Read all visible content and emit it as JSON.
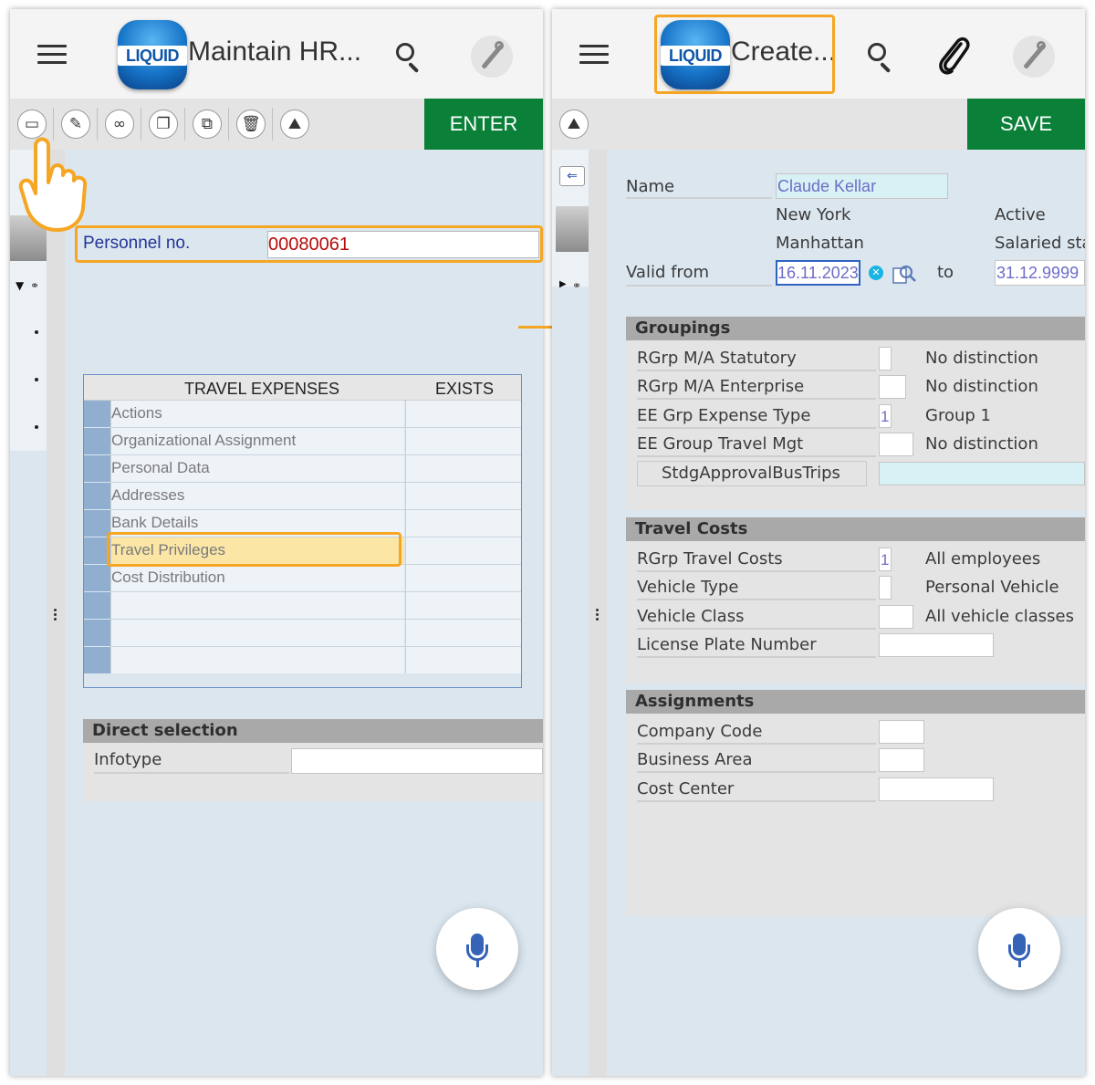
{
  "left": {
    "app_title": "Maintain HR...",
    "logo_text": "LIQUID",
    "enter_label": "ENTER",
    "toolbar_icons": [
      "create-icon",
      "change-icon",
      "display-icon",
      "copy-icon",
      "delimit-icon",
      "delete-icon",
      "overview-icon"
    ],
    "personnel_label": "Personnel no.",
    "personnel_value": "00080061",
    "table": {
      "headers": [
        "TRAVEL EXPENSES",
        "EXISTS"
      ],
      "rows": [
        "Actions",
        "Organizational Assignment",
        "Personal Data",
        "Addresses",
        "Bank Details",
        "Travel Privileges",
        "Cost Distribution",
        "",
        "",
        ""
      ],
      "highlighted": "Travel Privileges"
    },
    "direct_selection": {
      "title": "Direct selection",
      "infotype_label": "Infotype",
      "infotype_value": ""
    }
  },
  "right": {
    "app_title": "Create...",
    "logo_text": "LIQUID",
    "save_label": "SAVE",
    "header": {
      "name_label": "Name",
      "name_value": "Claude  Kellar",
      "city": "New York",
      "status": "Active",
      "area": "Manhattan",
      "group": "Salaried sta",
      "valid_from_label": "Valid from",
      "valid_from_value": "16.11.2023",
      "to_label": "to",
      "valid_to_value": "31.12.9999"
    },
    "groupings": {
      "title": "Groupings",
      "rows": [
        {
          "label": "RGrp M/A Statutory",
          "value": "",
          "text": "No distinction"
        },
        {
          "label": "RGrp M/A Enterprise",
          "value": "",
          "text": "No distinction"
        },
        {
          "label": "EE Grp Expense Type",
          "value": "1",
          "text": "Group 1"
        },
        {
          "label": "EE Group Travel Mgt",
          "value": "",
          "text": "No distinction"
        }
      ],
      "button_label": "StdgApprovalBusTrips"
    },
    "travel_costs": {
      "title": "Travel Costs",
      "rows": [
        {
          "label": "RGrp Travel Costs",
          "value": "1",
          "text": "All employees"
        },
        {
          "label": "Vehicle Type",
          "value": "",
          "text": "Personal Vehicle"
        },
        {
          "label": "Vehicle Class",
          "value": "",
          "text": "All vehicle classes"
        },
        {
          "label": "License Plate Number",
          "value": "",
          "text": ""
        }
      ]
    },
    "assignments": {
      "title": "Assignments",
      "rows": [
        {
          "label": "Company Code",
          "value": ""
        },
        {
          "label": "Business Area",
          "value": ""
        },
        {
          "label": "Cost Center",
          "value": ""
        }
      ]
    }
  },
  "colors": {
    "accent_green": "#0a8039",
    "highlight_orange": "#f5a623",
    "label_blue": "#23349a",
    "value_red": "#b50b0b"
  }
}
